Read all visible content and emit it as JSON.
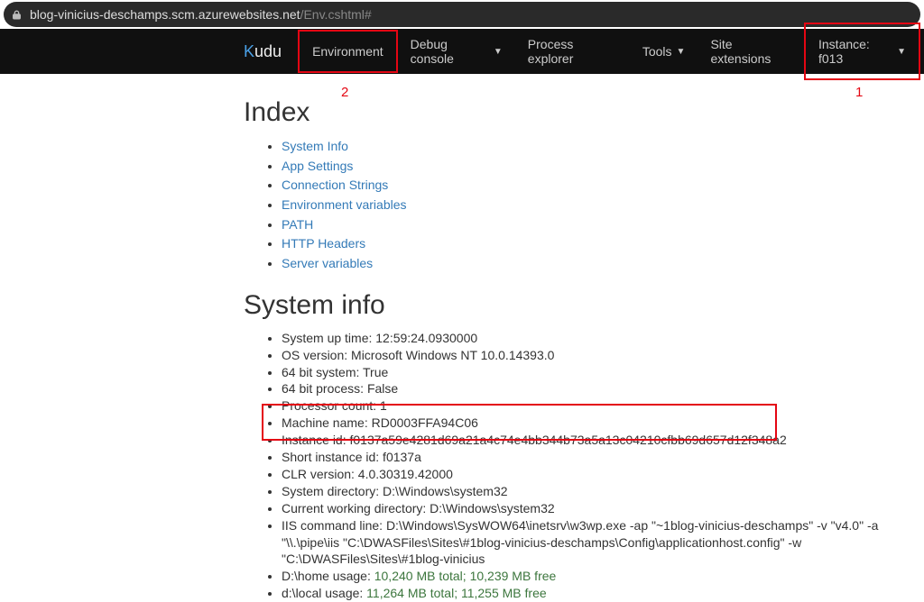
{
  "url": {
    "host": "blog-vinicius-deschamps.scm.azurewebsites.net",
    "path": "/Env.cshtml#"
  },
  "navbar": {
    "brand_k": "K",
    "brand_rest": "udu",
    "items": [
      {
        "label": "Environment",
        "dropdown": false
      },
      {
        "label": "Debug console",
        "dropdown": true
      },
      {
        "label": "Process explorer",
        "dropdown": false
      },
      {
        "label": "Tools",
        "dropdown": true
      },
      {
        "label": "Site extensions",
        "dropdown": false
      }
    ],
    "instance_label": "Instance: f013"
  },
  "annotations": {
    "one": "1",
    "two": "2"
  },
  "index": {
    "heading": "Index",
    "links": [
      "System Info",
      "App Settings",
      "Connection Strings",
      "Environment variables",
      "PATH",
      "HTTP Headers",
      "Server variables"
    ]
  },
  "sysinfo": {
    "heading": "System info",
    "items": [
      "System up time: 12:59:24.0930000",
      "OS version: Microsoft Windows NT 10.0.14393.0",
      "64 bit system: True",
      "64 bit process: False",
      "Processor count: 1",
      "Machine name: RD0003FFA94C06",
      "Instance id: f0137a59e4281d69a21a4c74e4bb344b73a5a13c04210cfbb69d657d12f348a2",
      "Short instance id: f0137a",
      "CLR version: 4.0.30319.42000",
      "System directory: D:\\Windows\\system32",
      "Current working directory: D:\\Windows\\system32",
      "IIS command line: D:\\Windows\\SysWOW64\\inetsrv\\w3wp.exe -ap \"~1blog-vinicius-deschamps\" -v \"v4.0\" -a \"\\\\.\\pipe\\iis \"C:\\DWASFiles\\Sites\\#1blog-vinicius-deschamps\\Config\\applicationhost.config\" -w \"C:\\DWASFiles\\Sites\\#1blog-vinicius"
    ],
    "home_usage_label": "D:\\home usage: ",
    "home_usage_value": "10,240 MB total; 10,239 MB free",
    "local_usage_label": "d:\\local usage: ",
    "local_usage_value": "11,264 MB total; 11,255 MB free"
  }
}
